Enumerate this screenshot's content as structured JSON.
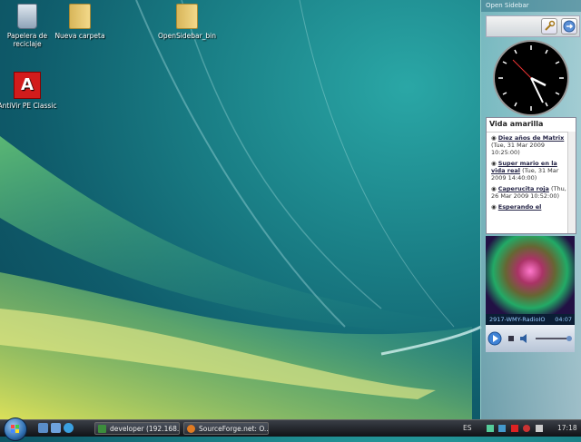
{
  "desktop": {
    "icons": [
      {
        "label": "Papelera de reciclaje"
      },
      {
        "label": "Nueva carpeta"
      },
      {
        "label": "OpenSidebar_bin"
      },
      {
        "label": "AntiVir PE Classic"
      }
    ]
  },
  "sidebar": {
    "title": "Open Sidebar",
    "feed": {
      "title": "Vida amarilla",
      "items": [
        {
          "headline": "Diez años de Matrix",
          "date": "(Tue, 31 Mar 2009 10:25:00)"
        },
        {
          "headline": "Super mario en la vida real",
          "date": "(Tue, 31 Mar 2009 14:40:00)"
        },
        {
          "headline": "Caperucita roja",
          "date": "(Thu, 26 Mar 2009 10:52:00)"
        },
        {
          "headline": "Esperando el",
          "date": ""
        }
      ]
    },
    "media": {
      "station": "2917-WMY-RadioIO",
      "time": "04:07"
    }
  },
  "taskbar": {
    "tasks": [
      {
        "label": "developer (192.168..."
      },
      {
        "label": "SourceForge.net: O..."
      }
    ],
    "lang": "ES",
    "clock": "17:18"
  },
  "colors": {
    "accent": "#2a9fa5",
    "taskbar": "#1a1d22"
  }
}
